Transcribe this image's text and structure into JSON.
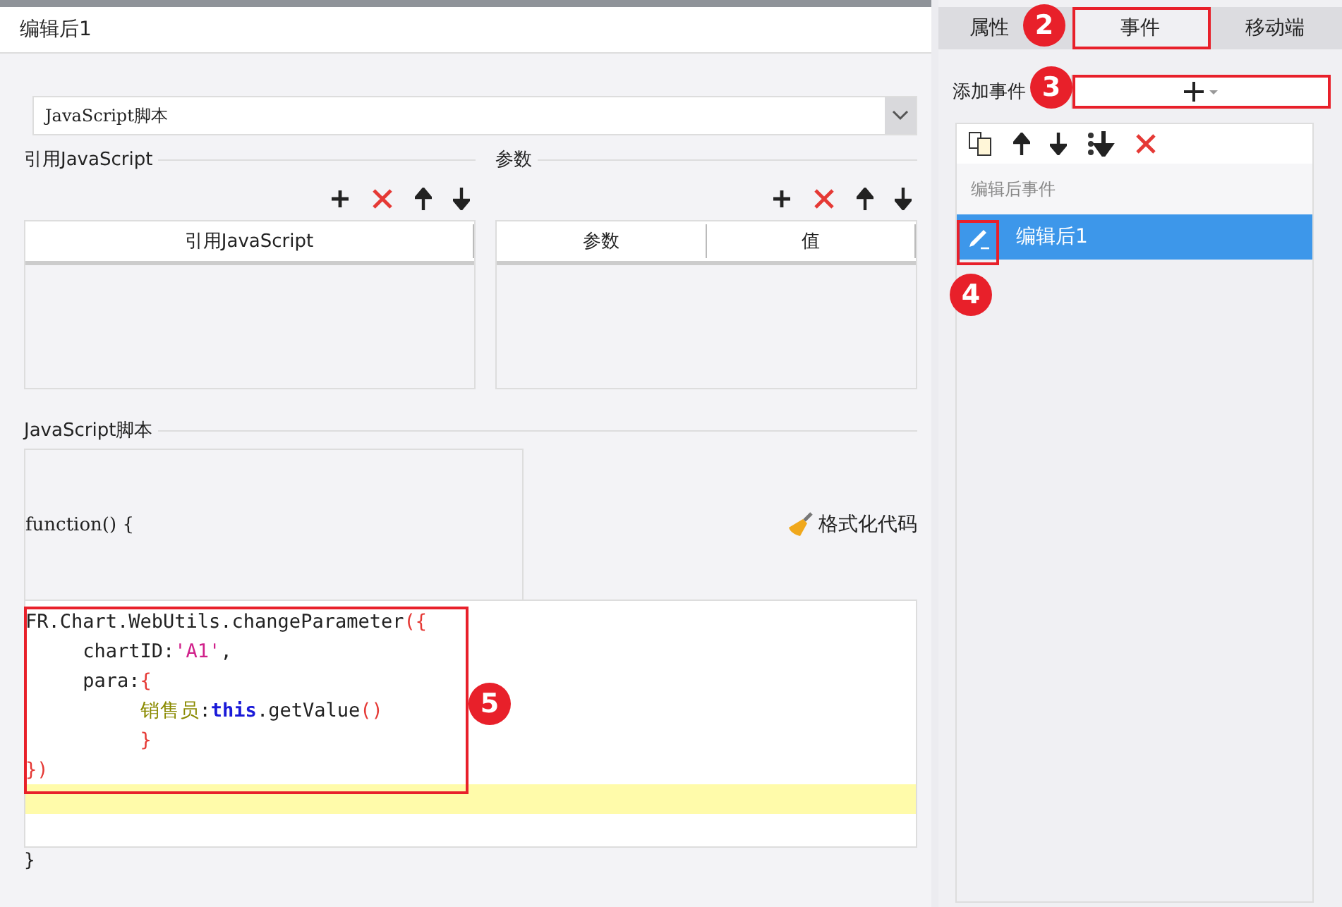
{
  "dialog": {
    "title": "编辑后1",
    "type_select": {
      "value": "JavaScript脚本"
    },
    "references": {
      "title": "引用JavaScript",
      "toolbar": [
        {
          "kind": "add"
        },
        {
          "kind": "delete"
        },
        {
          "kind": "up"
        },
        {
          "kind": "down"
        }
      ],
      "columns": [
        "引用JavaScript"
      ]
    },
    "parameters": {
      "title": "参数",
      "toolbar": [
        {
          "kind": "add"
        },
        {
          "kind": "delete"
        },
        {
          "kind": "up"
        },
        {
          "kind": "down"
        }
      ],
      "columns": [
        "参数",
        "值"
      ]
    },
    "script": {
      "title": "JavaScript脚本",
      "header": "function() {",
      "format_button": "格式化代码",
      "lines": [
        {
          "current": false,
          "tokens": [
            {
              "kind": "plain",
              "text": "FR.Chart.WebUtils.changeParameter"
            },
            {
              "kind": "bracket",
              "text": "({"
            }
          ]
        },
        {
          "current": false,
          "tokens": [
            {
              "kind": "plain",
              "text": "\tchartID:"
            },
            {
              "kind": "string",
              "text": "'A1'"
            },
            {
              "kind": "plain",
              "text": ","
            }
          ]
        },
        {
          "current": false,
          "tokens": [
            {
              "kind": "plain",
              "text": "\tpara:"
            },
            {
              "kind": "bracket",
              "text": "{"
            }
          ]
        },
        {
          "current": false,
          "tokens": [
            {
              "kind": "key",
              "text": "\t\t销售员"
            },
            {
              "kind": "plain",
              "text": ":"
            },
            {
              "kind": "keyword",
              "text": "this"
            },
            {
              "kind": "plain",
              "text": ".getValue"
            },
            {
              "kind": "bracket",
              "text": "()"
            }
          ]
        },
        {
          "current": false,
          "tokens": [
            {
              "kind": "bracket",
              "text": "\t\t}"
            }
          ]
        },
        {
          "current": false,
          "tokens": [
            {
              "kind": "bracket",
              "text": "})"
            }
          ]
        },
        {
          "current": true
        }
      ],
      "footer": "}"
    }
  },
  "side": {
    "tabs": [
      {
        "label": "属性",
        "selected": false
      },
      {
        "label": "事件",
        "selected": true
      },
      {
        "label": "移动端",
        "selected": false
      }
    ],
    "add_event_label": "添加事件",
    "toolbar": [
      {
        "kind": "copy"
      },
      {
        "kind": "up"
      },
      {
        "kind": "down"
      },
      {
        "kind": "bottom"
      },
      {
        "kind": "delete"
      }
    ],
    "events_group": "编辑后事件",
    "events": [
      {
        "label": "编辑后1",
        "selected": true
      }
    ]
  },
  "callouts": [
    {
      "number": "2"
    },
    {
      "number": "3"
    },
    {
      "number": "4"
    },
    {
      "number": "5"
    }
  ]
}
